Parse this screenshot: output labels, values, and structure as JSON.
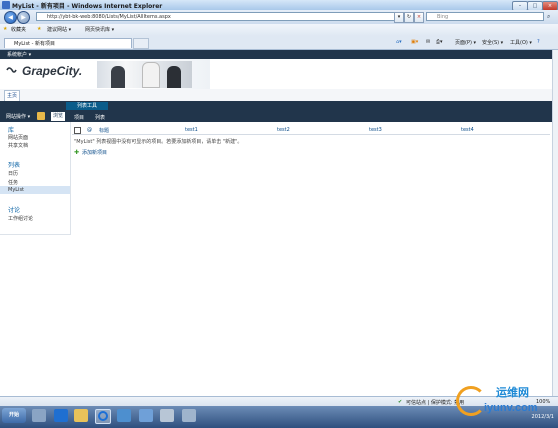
{
  "window": {
    "title": "MyList - 新有项目 - Windows Internet Explorer",
    "controls": [
      "–",
      "□",
      "×"
    ]
  },
  "address_bar": {
    "url": "http://ybt-bk-web:8080/Lists/MyList/AllItems.aspx",
    "search_placeholder": "Bing"
  },
  "favorites_bar": {
    "favorites_label": "收藏夹",
    "links": [
      "建议网站 ▾",
      "网页快讯库 ▾"
    ]
  },
  "browser_tab": {
    "label": "MyList - 新有项目"
  },
  "command_bar": {
    "items": [
      "页面(P) ▾",
      "安全(S) ▾",
      "工具(O) ▾",
      "?"
    ]
  },
  "sharepoint": {
    "site_bar_label": "系统帐户 ▾",
    "logo_text": "GrapeCity.",
    "top_nav": {
      "home": "主页"
    },
    "ribbon": {
      "context_group": "列表工具",
      "site_actions": "网站操作 ▾",
      "browse": "浏览",
      "tabs": [
        "项目",
        "列表"
      ]
    },
    "left_nav": {
      "sections": [
        {
          "heading": "库",
          "items": [
            "网站页面",
            "共享文档"
          ]
        },
        {
          "heading": "列表",
          "items": [
            "日历",
            "任务",
            "MyList"
          ]
        },
        {
          "heading": "讨论",
          "items": [
            "工作组讨论"
          ]
        }
      ],
      "selected": "MyList"
    },
    "list": {
      "columns": [
        "标题",
        "test1",
        "test2",
        "test3",
        "test4"
      ],
      "attachment_icon": "@",
      "empty_message": "\"MyList\" 列表视图中没有可显示的项目。若要添加新项目，请单击 \"新建\"。",
      "add_item": "添加新项目"
    }
  },
  "status_bar": {
    "zone": "可信站点 | 保护模式: 禁用",
    "zoom": "100%"
  },
  "taskbar": {
    "start_label": "开始",
    "date": "2012/3/1"
  },
  "watermark": {
    "line1": "运维网",
    "line2": "iyunv.com"
  },
  "colors": {
    "ribbon_dark": "#21354b",
    "context_tab": "#0b5c8a",
    "link_blue": "#0c4d8a",
    "nav_heading": "#0e65a6"
  }
}
